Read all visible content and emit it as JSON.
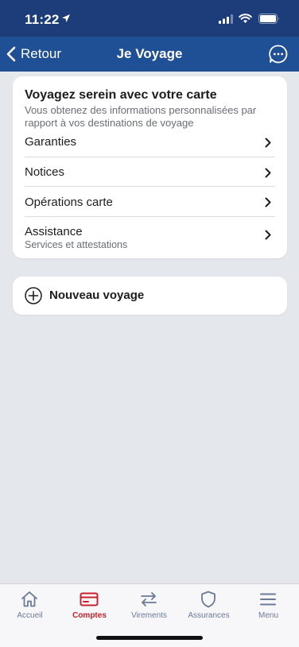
{
  "status_bar": {
    "time": "11:22"
  },
  "nav": {
    "back_label": "Retour",
    "title": "Je Voyage"
  },
  "info_card": {
    "title": "Voyagez serein avec votre carte",
    "description": "Vous obtenez des informations personnalisées par rapport à vos destinations de voyage",
    "items": [
      {
        "label": "Garanties",
        "sublabel": ""
      },
      {
        "label": "Notices",
        "sublabel": ""
      },
      {
        "label": "Opérations carte",
        "sublabel": ""
      },
      {
        "label": "Assistance",
        "sublabel": "Services et attestations"
      }
    ]
  },
  "new_trip": {
    "label": "Nouveau voyage"
  },
  "tab_bar": {
    "active_color": "#c8202a",
    "inactive_color": "#6b7a96",
    "tabs": [
      {
        "label": "Accueil",
        "icon": "home-icon",
        "active": false
      },
      {
        "label": "Comptes",
        "icon": "card-icon",
        "active": true
      },
      {
        "label": "Virements",
        "icon": "transfer-icon",
        "active": false
      },
      {
        "label": "Assurances",
        "icon": "shield-icon",
        "active": false
      },
      {
        "label": "Menu",
        "icon": "menu-icon",
        "active": false
      }
    ]
  }
}
